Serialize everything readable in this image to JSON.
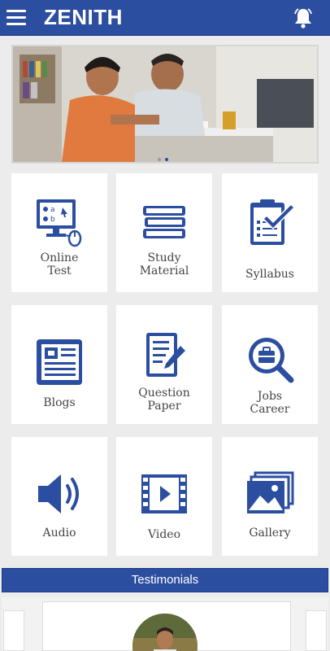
{
  "app": {
    "title": "ZENITH",
    "accent_color": "#2b4ea0"
  },
  "header": {
    "menu_icon": "hamburger-menu-icon",
    "notification_icon": "bell-icon"
  },
  "banner": {
    "image": "photo of a father helping his son study at a desk",
    "carousel_dots": 2,
    "active_dot": 2
  },
  "tiles": [
    {
      "label": "Online\nTest",
      "icon": "online-test-icon"
    },
    {
      "label": "Study\nMaterial",
      "icon": "books-icon"
    },
    {
      "label": "Syllabus",
      "icon": "clipboard-check-icon"
    },
    {
      "label": "Blogs",
      "icon": "newspaper-icon"
    },
    {
      "label": "Question\nPaper",
      "icon": "question-paper-icon"
    },
    {
      "label": "Jobs\nCareer",
      "icon": "job-search-icon"
    },
    {
      "label": "Audio",
      "icon": "speaker-icon"
    },
    {
      "label": "Video",
      "icon": "video-icon"
    },
    {
      "label": "Gallery",
      "icon": "gallery-icon"
    }
  ],
  "testimonials": {
    "title": "Testimonials"
  }
}
